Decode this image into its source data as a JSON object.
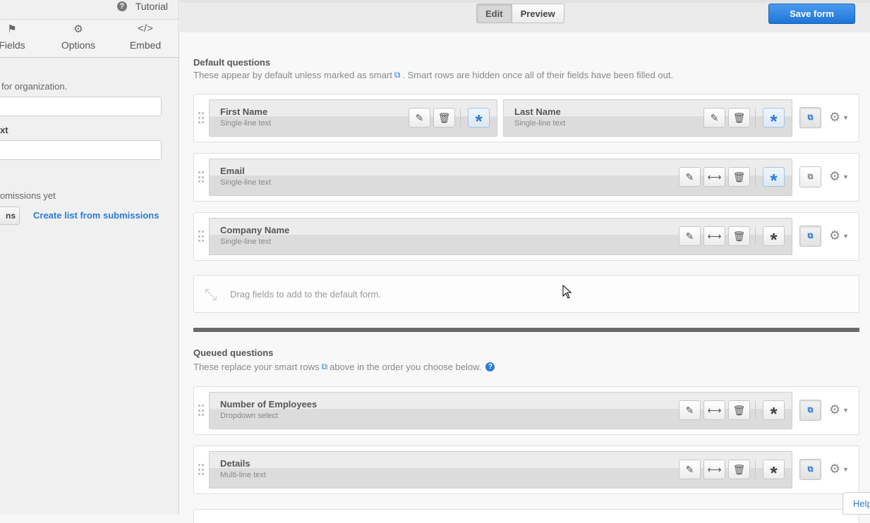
{
  "sidebar": {
    "tutorial_label": "Tutorial",
    "tabs": [
      {
        "label": "Fields",
        "icon": "flag-icon"
      },
      {
        "label": "Options",
        "icon": "gear-icon"
      },
      {
        "label": "Embed",
        "icon": "code-icon"
      }
    ],
    "org_text": "for organization.",
    "text_label": "xt",
    "submissions_text": "omissions yet",
    "button_fragment": "ns",
    "create_list_link": "Create list from submissions"
  },
  "toolbar": {
    "edit_label": "Edit",
    "preview_label": "Preview",
    "save_label": "Save form"
  },
  "default_section": {
    "title": "Default questions",
    "desc_before": "These appear by default unless marked as smart",
    "desc_after": ". Smart rows are hidden once all of their fields have been filled out."
  },
  "fields": {
    "first_name": {
      "name": "First Name",
      "type": "Single-line text"
    },
    "last_name": {
      "name": "Last Name",
      "type": "Single-line text"
    },
    "email": {
      "name": "Email",
      "type": "Single-line text"
    },
    "company": {
      "name": "Company Name",
      "type": "Single-line text"
    },
    "employees": {
      "name": "Number of Employees",
      "type": "Dropdown select"
    },
    "details": {
      "name": "Details",
      "type": "Multi-line text"
    }
  },
  "drop_zone_text": "Drag fields to add to the default form.",
  "queued_section": {
    "title": "Queued questions",
    "desc_before": "These replace your smart rows",
    "desc_after": "above in the order you choose below."
  },
  "help_tab": "Help",
  "icons": {
    "edit": "pencil-icon",
    "delete": "trash-icon",
    "resize": "arrows-horizontal-icon",
    "required": "asterisk-icon",
    "smart": "smart-link-icon",
    "settings": "gear-icon"
  },
  "colors": {
    "accent": "#2a7bd6",
    "save_button": "#1f74d6",
    "divider": "#6a6a6a"
  }
}
